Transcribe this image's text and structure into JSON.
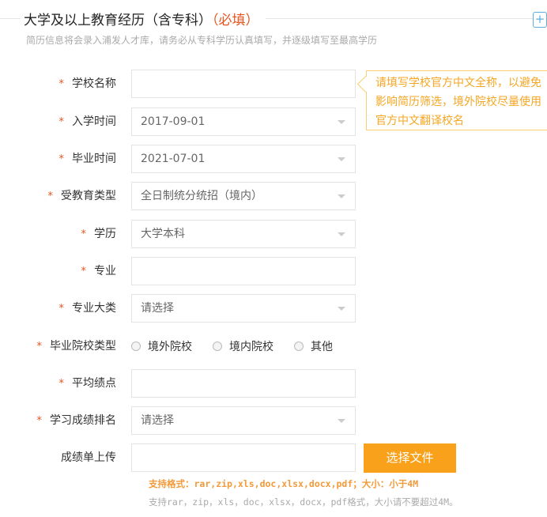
{
  "header": {
    "title": "大学及以上教育经历（含专科）",
    "required": "（必填）",
    "add": "+",
    "subtitle": "简历信息将会录入浦发人才库，请务必从专科学历认真填写，并逐级填写至最高学历"
  },
  "tooltip": "请填写学校官方中文全称，以避免影响简历筛选，境外院校尽量使用官方中文翻译校名",
  "fields": [
    {
      "label": "学校名称",
      "required": true,
      "type": "text",
      "value": ""
    },
    {
      "label": "入学时间",
      "required": true,
      "type": "select",
      "value": "2017-09-01"
    },
    {
      "label": "毕业时间",
      "required": true,
      "type": "select",
      "value": "2021-07-01"
    },
    {
      "label": "受教育类型",
      "required": true,
      "type": "select",
      "value": "全日制统分统招（境内）"
    },
    {
      "label": "学历",
      "required": true,
      "type": "select",
      "value": "大学本科"
    },
    {
      "label": "专业",
      "required": true,
      "type": "text",
      "value": ""
    },
    {
      "label": "专业大类",
      "required": true,
      "type": "select",
      "value": "请选择"
    },
    {
      "label": "毕业院校类型",
      "required": true,
      "type": "radio",
      "options": [
        "境外院校",
        "境内院校",
        "其他"
      ]
    },
    {
      "label": "平均绩点",
      "required": true,
      "type": "text",
      "value": ""
    },
    {
      "label": "学习成绩排名",
      "required": true,
      "type": "select",
      "value": "请选择"
    },
    {
      "label": "成绩单上传",
      "required": false,
      "type": "file",
      "value": ""
    }
  ],
  "star": "*",
  "upload": {
    "button": "选择文件",
    "formats": "支持格式：rar,zip,xls,doc,xlsx,docx,pdf；大小：小于4M",
    "note": "支持rar，zip，xls，doc，xlsx，docx，pdf格式，大小请不要超过4M。"
  },
  "colors": {
    "accent": "#f9a11b",
    "required": "#e8541e"
  }
}
